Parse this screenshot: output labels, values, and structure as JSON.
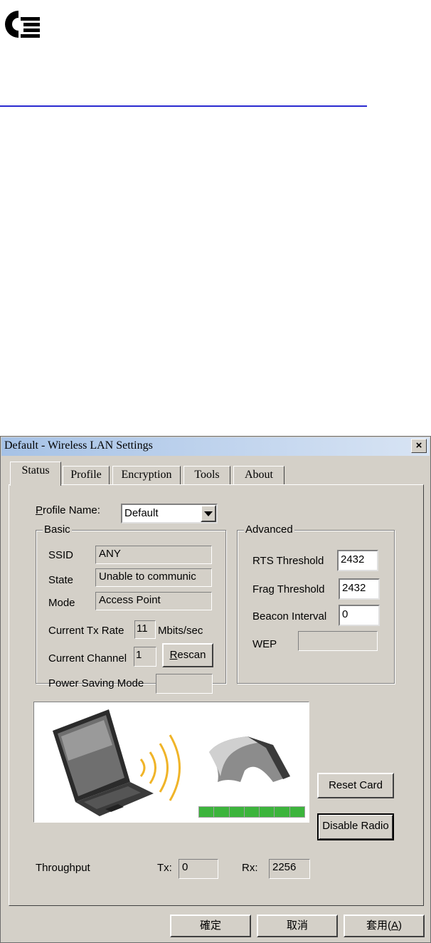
{
  "window": {
    "title": "Default - Wireless LAN Settings",
    "close_label": "×"
  },
  "tabs": [
    {
      "label": "Status",
      "active": true
    },
    {
      "label": "Profile",
      "active": false
    },
    {
      "label": "Encryption",
      "active": false
    },
    {
      "label": "Tools",
      "active": false
    },
    {
      "label": "About",
      "active": false
    }
  ],
  "profile": {
    "label_accel": "P",
    "label_rest": "rofile Name:",
    "value": "Default"
  },
  "basic": {
    "title": "Basic",
    "ssid_label": "SSID",
    "ssid_value": "ANY",
    "state_label": "State",
    "state_value": "Unable to communic",
    "mode_label": "Mode",
    "mode_value": "Access Point",
    "tx_rate_label": "Current Tx Rate",
    "tx_rate_value": "11",
    "tx_rate_unit": "Mbits/sec",
    "channel_label": "Current Channel",
    "channel_value": "1",
    "rescan_accel": "R",
    "rescan_rest": "escan",
    "power_label": "Power Saving Mode",
    "power_value": ""
  },
  "advanced": {
    "title": "Advanced",
    "rts_label": "RTS Threshold",
    "rts_value": "2432",
    "frag_label": "Frag Threshold",
    "frag_value": "2432",
    "beacon_label": "Beacon Interval",
    "beacon_value": "0",
    "wep_label": "WEP",
    "wep_value": ""
  },
  "signal": {
    "segments": 7,
    "lit_segments": 7,
    "color": "#3cb43c"
  },
  "actions": {
    "reset_label": "Reset Card",
    "disable_label": "Disable Radio"
  },
  "throughput": {
    "label": "Throughput",
    "tx_label": "Tx:",
    "tx_value": "0",
    "rx_label": "Rx:",
    "rx_value": "2256"
  },
  "footer": {
    "ok_label": "確定",
    "cancel_label": "取消",
    "apply_label": "套用(",
    "apply_accel": "A",
    "apply_close": ")"
  },
  "colors": {
    "dialog_bg": "#d4d0c8",
    "rule": "#2a2ad0",
    "wave": "#f0b428"
  }
}
